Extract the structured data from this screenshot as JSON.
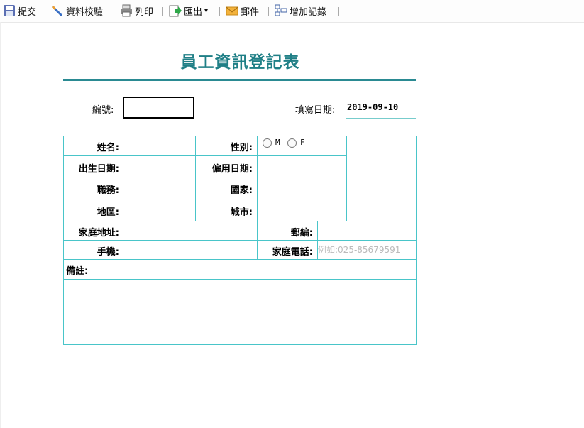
{
  "toolbar": {
    "submit": "提交",
    "validate": "資料校驗",
    "print": "列印",
    "export": "匯出",
    "export_arrow": "▾",
    "mail": "郵件",
    "add_record": "增加記錄"
  },
  "form": {
    "title": "員工資訊登記表",
    "number_label": "編號:",
    "fill_date_label": "填寫日期:",
    "fill_date_value": "2019-09-10",
    "name_label": "姓名:",
    "gender_label": "性別:",
    "gender_options": [
      "M",
      "F"
    ],
    "birth_label": "出生日期:",
    "hire_label": "僱用日期:",
    "position_label": "職務:",
    "country_label": "國家:",
    "region_label": "地區:",
    "city_label": "城市:",
    "address_label": "家庭地址:",
    "zip_label": "郵編:",
    "mobile_label": "手機:",
    "home_phone_label": "家庭電話:",
    "home_phone_placeholder": "例如:025-85679591",
    "remark_label": "備註:"
  }
}
